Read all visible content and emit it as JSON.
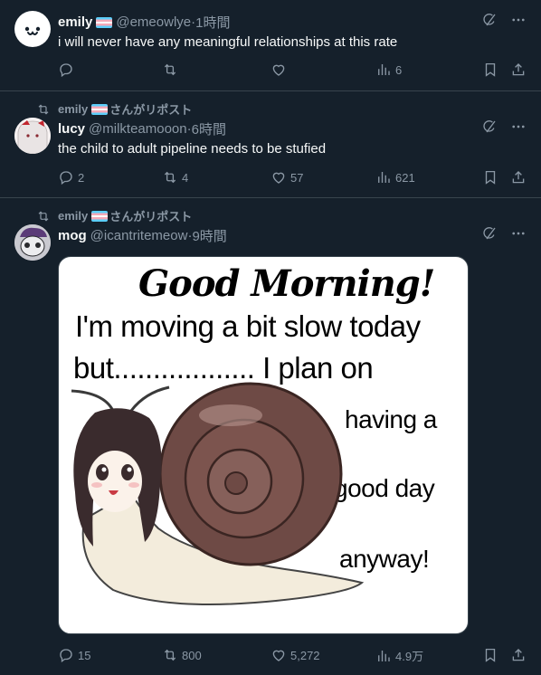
{
  "tweets": [
    {
      "name": "emily",
      "handle": "@emeowlye",
      "time": "1時間",
      "text": "i will never have any meaningful relationships at this rate",
      "stats": {
        "replies": "",
        "retweets": "",
        "likes": "",
        "views": "6"
      }
    },
    {
      "retweeted_by": "emily",
      "retweet_suffix": "さんがリポスト",
      "name": "lucy",
      "handle": "@milkteamooon",
      "time": "6時間",
      "text": "the child to adult pipeline needs to be stufied",
      "stats": {
        "replies": "2",
        "retweets": "4",
        "likes": "57",
        "views": "621"
      }
    },
    {
      "retweeted_by": "emily",
      "retweet_suffix": "さんがリポスト",
      "name": "mog",
      "handle": "@icantritemeow",
      "time": "9時間",
      "media": {
        "title": "Good Morning!",
        "line1": "I'm moving a bit slow today",
        "line2": "but.................. I plan on",
        "line3": "having a",
        "line4": "good day",
        "line5": "anyway!"
      },
      "stats": {
        "replies": "15",
        "retweets": "800",
        "likes": "5,272",
        "views": "4.9万"
      }
    }
  ],
  "separator": " · ",
  "colors": {
    "background": "#15202b",
    "muted": "#8b98a5",
    "border": "#38444d",
    "text": "#f7f9f9"
  }
}
